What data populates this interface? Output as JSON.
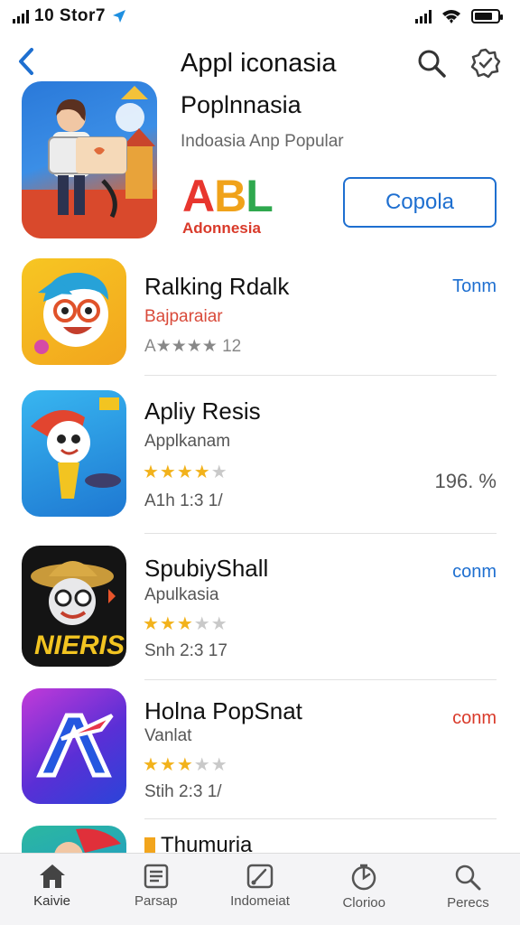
{
  "status_bar": {
    "time": "10 Stor7"
  },
  "header": {
    "title_line1": "Appl iconasia",
    "title_line2": "Poplnnasia",
    "subtitle": "Indoasia Anp Popular",
    "logo_text": [
      "A",
      "B",
      "L"
    ],
    "logo_sub": "Adonnesia",
    "cta_label": "Copola"
  },
  "apps": [
    {
      "name": "Ralking Rdalk",
      "category": "Bajparaiar",
      "rating_text": "A★★★★ 12",
      "stars": 4,
      "action": "Tonm",
      "action_color": "#1e6fd0"
    },
    {
      "name": "Apliy Resis",
      "category": "Applkanam",
      "stars": 4,
      "meta": "A1h 1:3  1/",
      "action": "196. %",
      "action_color": "#555555"
    },
    {
      "name": "SpubiyShall",
      "category": "Apulkasia",
      "stars": 3,
      "meta": "Snh 2:3  17",
      "action": "conm",
      "action_color": "#1e6fd0"
    },
    {
      "name": "Holna PopSnat",
      "category": "Vanlat",
      "stars": 3,
      "meta": "Stih 2:3  1/",
      "action": "conm",
      "action_color": "#d93a2a"
    },
    {
      "name": "Thumuria"
    }
  ],
  "tabs": [
    {
      "label": "Kaivie",
      "icon": "home-icon"
    },
    {
      "label": "Parsap",
      "icon": "document-icon"
    },
    {
      "label": "Indomeiat",
      "icon": "gauge-icon"
    },
    {
      "label": "Clorioo",
      "icon": "globe-icon"
    },
    {
      "label": "Perecs",
      "icon": "search-icon"
    }
  ],
  "colors": {
    "accent": "#1e6fd0",
    "star": "#f2b21b"
  }
}
